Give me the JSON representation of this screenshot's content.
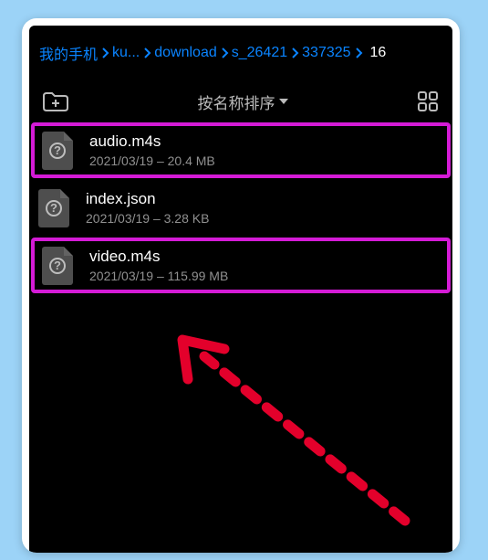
{
  "breadcrumb": {
    "items": [
      "我的手机",
      "ku...",
      "download",
      "s_26421",
      "337325"
    ],
    "count": "16"
  },
  "toolbar": {
    "sort_label": "按名称排序"
  },
  "files": [
    {
      "name": "audio.m4s",
      "date": "2021/03/19",
      "size": "20.4 MB",
      "highlighted": true
    },
    {
      "name": "index.json",
      "date": "2021/03/19",
      "size": "3.28 KB",
      "highlighted": false
    },
    {
      "name": "video.m4s",
      "date": "2021/03/19",
      "size": "115.99 MB",
      "highlighted": true
    }
  ],
  "annotation": {
    "arrow_color": "#e3002b"
  }
}
